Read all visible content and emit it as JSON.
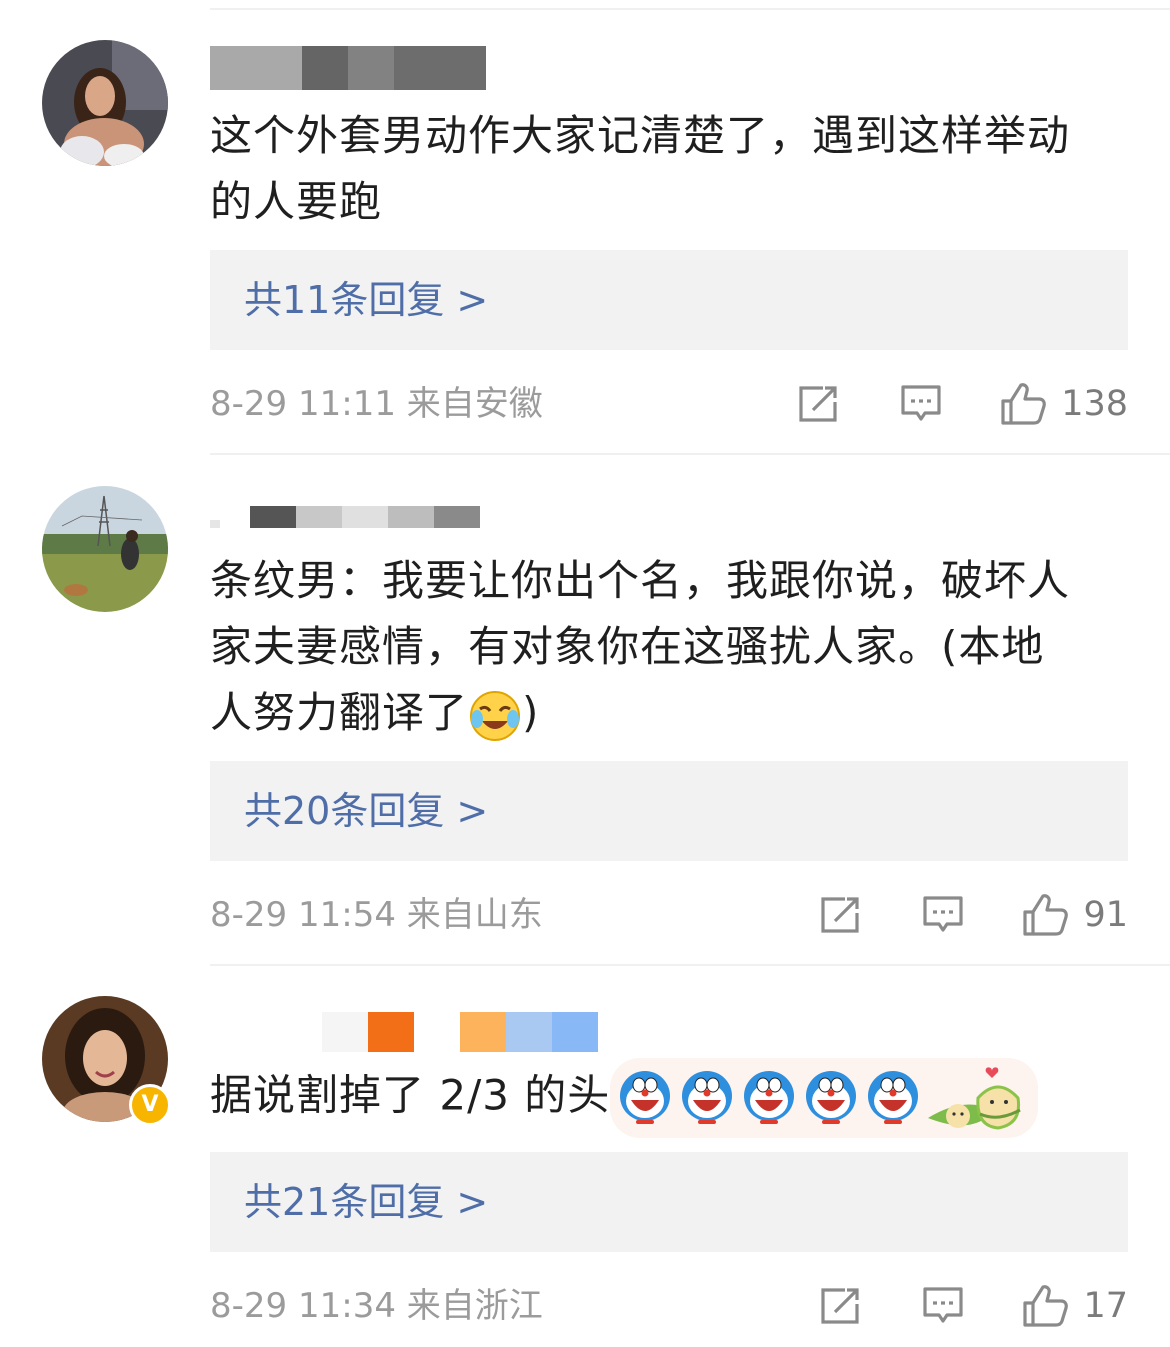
{
  "comments": [
    {
      "text_lines": [
        "这个外套男动作大家记清楚了，遇到这样举动",
        "的人要跑"
      ],
      "reply_label": "共11条回复 >",
      "time": "8-29 11:11",
      "source": "来自安徽",
      "likes": "138",
      "icons": [
        "share-icon",
        "comment-icon",
        "like-icon"
      ]
    },
    {
      "text_lines": [
        "条纹男：我要让你出个名，我跟你说，破坏人",
        "家夫妻感情，有对象你在这骚扰人家。(本地",
        "人努力翻译了"
      ],
      "text_tail": ")",
      "reply_label": "共20条回复 >",
      "time": "8-29 11:54",
      "source": "来自山东",
      "likes": "91",
      "icons": [
        "share-icon",
        "comment-icon",
        "like-icon"
      ]
    },
    {
      "text_lines": [
        "据说割掉了 2/3 的头"
      ],
      "reply_label": "共21条回复 >",
      "time": "8-29 11:34",
      "source": "来自浙江",
      "likes": "17",
      "verified_badge": "V",
      "icons": [
        "share-icon",
        "comment-icon",
        "like-icon"
      ]
    }
  ],
  "colors": {
    "link": "#4f6ea8",
    "meta_text": "#9b9b9b",
    "reply_bg": "#f2f2f2",
    "verified": "#f7b500"
  }
}
